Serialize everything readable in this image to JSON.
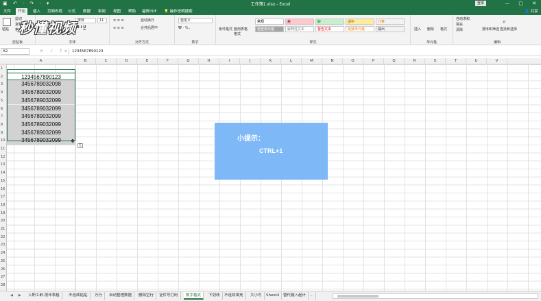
{
  "window": {
    "title": "工作簿1.xlsx - Excel",
    "signin": "登录",
    "controls": [
      "—",
      "▢",
      "✕"
    ]
  },
  "qat": "▣ ↶ · ↷ · ▾",
  "tabs": [
    "文件",
    "开始",
    "插入",
    "页面布局",
    "公式",
    "数据",
    "审阅",
    "视图",
    "帮助",
    "福昕PDF",
    "操作说明搜索"
  ],
  "share": "共享",
  "ribbon": {
    "clipboard": {
      "paste": "粘贴",
      "cut": "剪切",
      "copy": "复制",
      "painter": "格式刷",
      "label": "剪贴板"
    },
    "font": {
      "family": "宋体",
      "size": "11",
      "label": "字体"
    },
    "align": {
      "wrap": "自动换行",
      "merge": "合并后居中",
      "label": "对齐方式"
    },
    "number": {
      "format": "自定义",
      "label": "数字"
    },
    "styles": {
      "cond": "条件格式",
      "table": "套用表格格式",
      "cells": [
        {
          "text": "常规",
          "bg": "#ffffff",
          "fg": "#000000"
        },
        {
          "text": "差",
          "bg": "#ffc7ce",
          "fg": "#9c0006"
        },
        {
          "text": "好",
          "bg": "#c6efce",
          "fg": "#006100"
        },
        {
          "text": "适中",
          "bg": "#ffeb9c",
          "fg": "#9c5700"
        },
        {
          "text": "计算",
          "bg": "#f2f2f2",
          "fg": "#fa7d00"
        },
        {
          "text": "检查单元格",
          "bg": "#a5a5a5",
          "fg": "#ffffff"
        },
        {
          "text": "解释性文本",
          "bg": "#ffffff",
          "fg": "#7f7f7f"
        },
        {
          "text": "警告文本",
          "bg": "#ffffff",
          "fg": "#ff0000"
        },
        {
          "text": "链接单元格",
          "bg": "#ffffff",
          "fg": "#fa7d00"
        },
        {
          "text": "输出",
          "bg": "#f2f2f2",
          "fg": "#3f3f3f"
        }
      ],
      "label": "样式"
    },
    "cells_grp": {
      "insert": "插入",
      "delete": "删除",
      "format": "格式",
      "label": "单元格"
    },
    "editing": {
      "autosum": "自动求和",
      "fill": "填充",
      "clear": "清除",
      "sort": "排序和筛选",
      "find": "查找和选择",
      "label": "编辑"
    }
  },
  "formula_bar": {
    "namebox": "A2",
    "content": "1234567890123"
  },
  "columns": [
    "A",
    "B",
    "C",
    "D",
    "E",
    "F",
    "G",
    "H",
    "I",
    "J",
    "K",
    "L",
    "M",
    "N",
    "O",
    "P",
    "Q",
    "R",
    "S",
    "T",
    "U",
    "V"
  ],
  "rows": [
    "1",
    "2",
    "3",
    "4",
    "5",
    "6",
    "7",
    "8",
    "9",
    "10",
    "11",
    "12",
    "13",
    "14",
    "15",
    "16",
    "17",
    "18",
    "19",
    "20",
    "21",
    "22",
    "23",
    "24",
    "25",
    "26",
    "27",
    "28"
  ],
  "cells": [
    "1234567890123",
    "3456789032098",
    "3456789032099",
    "3456789032099",
    "3456789032099",
    "3456789032099",
    "3456789032099",
    "3456789032099",
    "3456789032099"
  ],
  "tip": {
    "title": "小提示：",
    "body": "CTRL+1"
  },
  "watermark": "秒懂视频",
  "sheets": [
    "入职工龄·按年表格",
    "不连续粘贴",
    "万行",
    "自动整理数据",
    "删除空行",
    "证件号打码",
    "数字格式",
    "下划线",
    "不连续填充",
    "大小写",
    "Sheet4",
    "替代输入起计",
    "..."
  ],
  "active_sheet": "数字格式",
  "quick_analysis": "⎘"
}
